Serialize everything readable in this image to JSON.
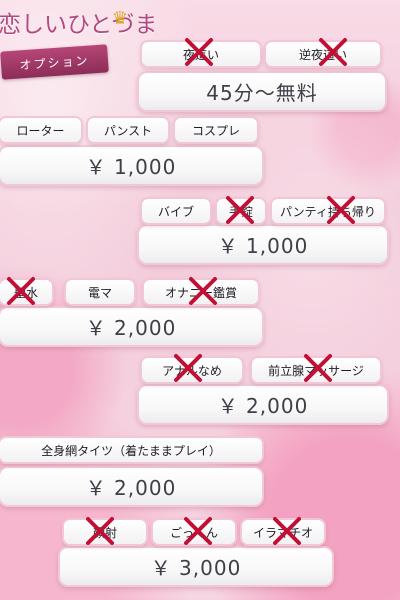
{
  "header": {
    "logo_text": "恋しいひとづま",
    "badge": "オプション"
  },
  "groups": [
    {
      "tags": [
        {
          "label": "夜這い",
          "unavailable": true
        },
        {
          "label": "逆夜這い",
          "unavailable": true
        }
      ],
      "price": "45分〜無料"
    },
    {
      "tags": [
        {
          "label": "ローター",
          "unavailable": false
        },
        {
          "label": "パンスト",
          "unavailable": false
        },
        {
          "label": "コスプレ",
          "unavailable": false
        }
      ],
      "price": "￥ 1,000"
    },
    {
      "tags": [
        {
          "label": "バイブ",
          "unavailable": false
        },
        {
          "label": "手錠",
          "unavailable": true
        },
        {
          "label": "パンティ持ち帰り",
          "unavailable": true
        }
      ],
      "price": "￥ 1,000"
    },
    {
      "tags": [
        {
          "label": "聖水",
          "unavailable": true
        },
        {
          "label": "電マ",
          "unavailable": false
        },
        {
          "label": "オナニー鑑賞",
          "unavailable": true
        }
      ],
      "price": "￥ 2,000"
    },
    {
      "tags": [
        {
          "label": "アナルなめ",
          "unavailable": true
        },
        {
          "label": "前立腺マッサージ",
          "unavailable": true
        }
      ],
      "price": "￥ 2,000"
    },
    {
      "tags": [
        {
          "label": "全身網タイツ（着たままプレイ）",
          "unavailable": false
        }
      ],
      "price": "￥ 2,000"
    },
    {
      "tags": [
        {
          "label": "顔射",
          "unavailable": true
        },
        {
          "label": "ごっくん",
          "unavailable": true
        },
        {
          "label": "イラマチオ",
          "unavailable": true
        }
      ],
      "price": "￥ 3,000"
    }
  ]
}
